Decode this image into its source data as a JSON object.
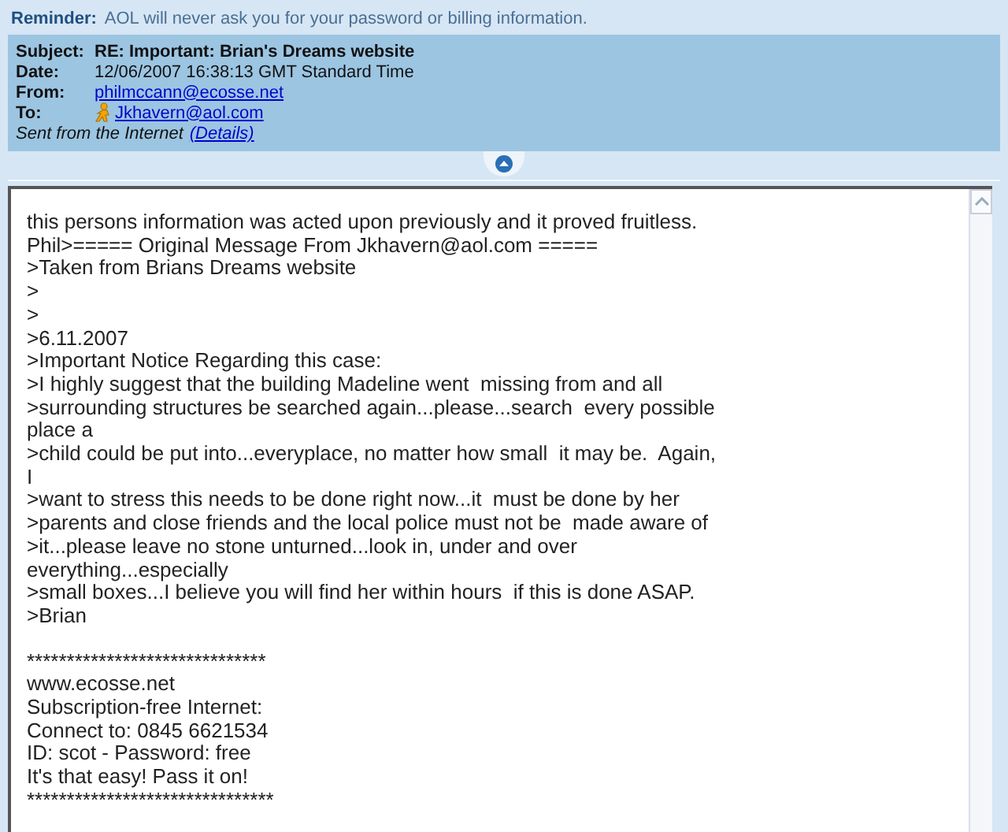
{
  "reminder": {
    "label": "Reminder:",
    "text": "AOL will never ask you for your password or billing information."
  },
  "header": {
    "fields": [
      {
        "label": "Subject:",
        "value": "RE: Important: Brian's Dreams website",
        "kind": "bold"
      },
      {
        "label": "Date:",
        "value": "12/06/2007 16:38:13 GMT Standard Time",
        "kind": "plain"
      },
      {
        "label": "From:",
        "value": "philmccann@ecosse.net",
        "kind": "link"
      },
      {
        "label": "To:",
        "value": "Jkhavern@aol.com",
        "kind": "contact"
      }
    ],
    "note": "Sent from the Internet",
    "details_link": "(Details)"
  },
  "body": {
    "lines": [
      "this persons information was acted upon previously and it proved fruitless.",
      "Phil>===== Original Message From Jkhavern@aol.com =====",
      ">Taken from Brians Dreams website",
      ">",
      ">",
      ">6.11.2007",
      ">Important Notice Regarding this case:",
      ">I highly suggest that the building Madeline went  missing from and all",
      ">surrounding structures be searched again...please...search  every possible",
      "place a",
      ">child could be put into...everyplace, no matter how small  it may be.  Again,",
      "I",
      ">want to stress this needs to be done right now...it  must be done by her",
      ">parents and close friends and the local police must not be  made aware of",
      ">it...please leave no stone unturned...look in, under and over",
      "everything...especially",
      ">small boxes...I believe you will find her within hours  if this is done ASAP.",
      ">Brian"
    ],
    "signature": [
      "******************************",
      "www.ecosse.net",
      "Subscription-free Internet:",
      "Connect to: 0845 6621534",
      "ID: scot - Password: free",
      "It's that easy! Pass it on!",
      "*******************************"
    ]
  }
}
